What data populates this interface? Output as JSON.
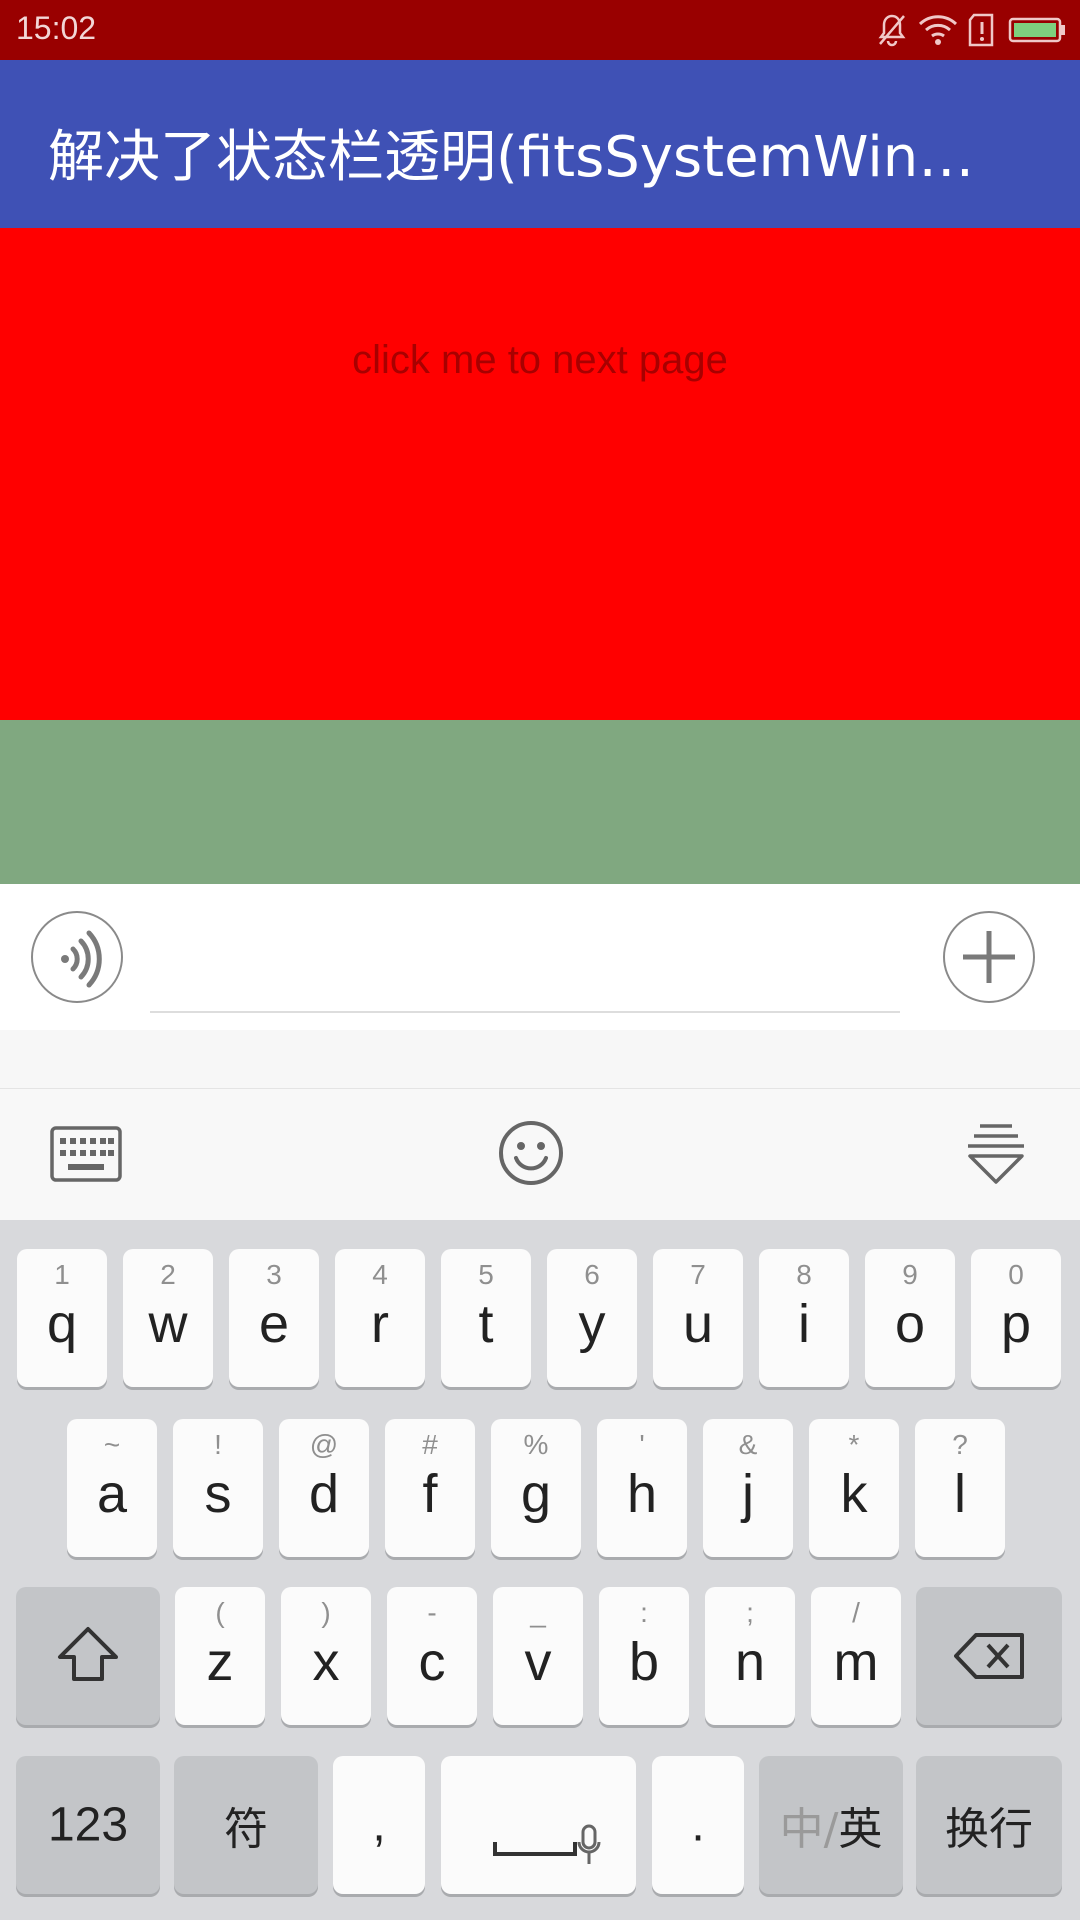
{
  "status_bar": {
    "time": "15:02",
    "icons": [
      "mute-notification-icon",
      "wifi-icon",
      "alert-icon",
      "battery-icon"
    ],
    "background": "#990000"
  },
  "app_bar": {
    "title": "解决了状态栏透明(fitsSystemWin…",
    "background": "#3f51b5"
  },
  "content": {
    "red_panel_text": "click me to next page",
    "red_panel_color": "#ff0000",
    "green_band_color": "#80a880"
  },
  "input_bar": {
    "voice_icon": "voice-icon",
    "add_icon": "plus-icon",
    "input_value": ""
  },
  "keyboard_toolbar": {
    "icons": [
      "keyboard-icon",
      "emoji-icon",
      "collapse-keyboard-icon"
    ]
  },
  "keyboard": {
    "row1": [
      {
        "hint": "1",
        "key": "q"
      },
      {
        "hint": "2",
        "key": "w"
      },
      {
        "hint": "3",
        "key": "e"
      },
      {
        "hint": "4",
        "key": "r"
      },
      {
        "hint": "5",
        "key": "t"
      },
      {
        "hint": "6",
        "key": "y"
      },
      {
        "hint": "7",
        "key": "u"
      },
      {
        "hint": "8",
        "key": "i"
      },
      {
        "hint": "9",
        "key": "o"
      },
      {
        "hint": "0",
        "key": "p"
      }
    ],
    "row2": [
      {
        "hint": "~",
        "key": "a"
      },
      {
        "hint": "!",
        "key": "s"
      },
      {
        "hint": "@",
        "key": "d"
      },
      {
        "hint": "#",
        "key": "f"
      },
      {
        "hint": "%",
        "key": "g"
      },
      {
        "hint": "'",
        "key": "h"
      },
      {
        "hint": "&",
        "key": "j"
      },
      {
        "hint": "*",
        "key": "k"
      },
      {
        "hint": "?",
        "key": "l"
      }
    ],
    "row3": [
      {
        "hint": "(",
        "key": "z"
      },
      {
        "hint": ")",
        "key": "x"
      },
      {
        "hint": "-",
        "key": "c"
      },
      {
        "hint": "_",
        "key": "v"
      },
      {
        "hint": ":",
        "key": "b"
      },
      {
        "hint": ";",
        "key": "n"
      },
      {
        "hint": "/",
        "key": "m"
      }
    ],
    "bottom": {
      "numbers_label": "123",
      "symbols_label": "符",
      "comma_label": ",",
      "period_label": ".",
      "lang_dim": "中/",
      "lang_active": "英",
      "enter_label": "换行"
    }
  }
}
